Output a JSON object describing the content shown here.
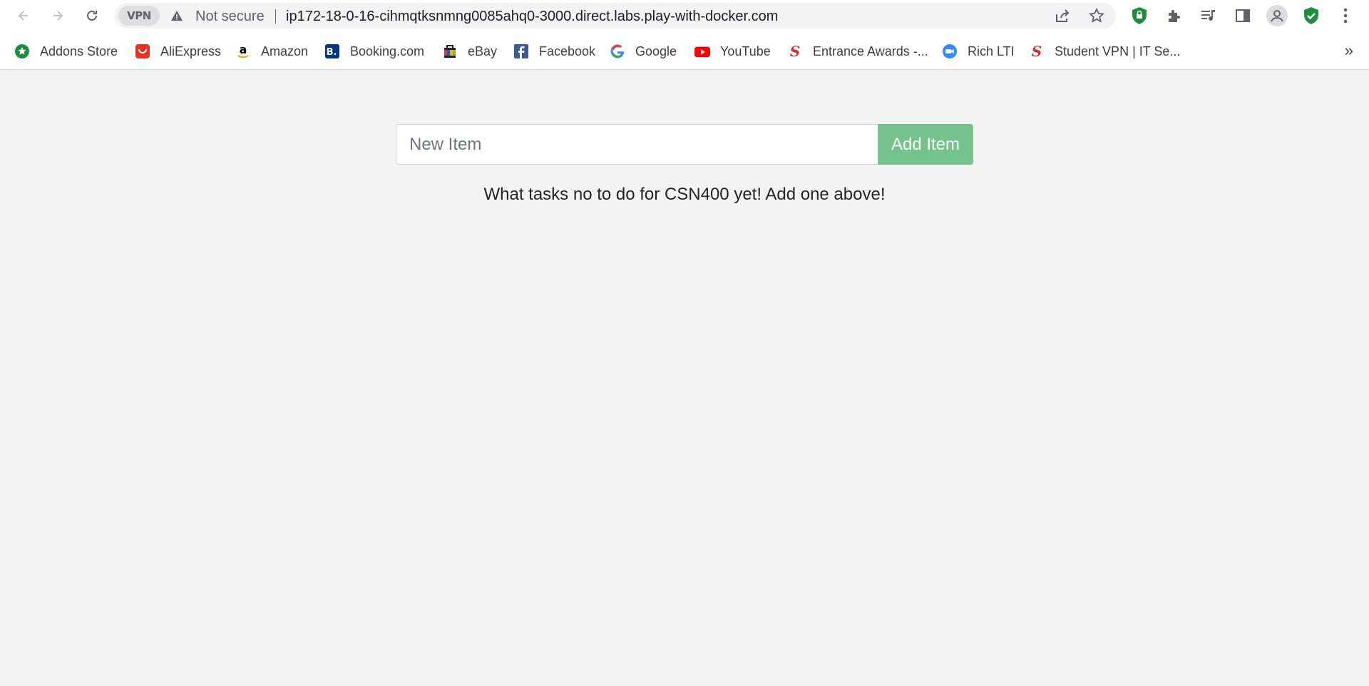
{
  "browser": {
    "vpn_label": "VPN",
    "security_label": "Not secure",
    "url": "ip172-18-0-16-cihmqtksnmng0085ahq0-3000.direct.labs.play-with-docker.com"
  },
  "bookmarks": [
    {
      "label": "Addons Store",
      "icon": "addons-store-icon",
      "color": "#1e8e3e"
    },
    {
      "label": "AliExpress",
      "icon": "aliexpress-icon",
      "color": "#e43225"
    },
    {
      "label": "Amazon",
      "icon": "amazon-icon",
      "color": "#000000"
    },
    {
      "label": "Booking.com",
      "icon": "booking-icon",
      "color": "#003580"
    },
    {
      "label": "eBay",
      "icon": "ebay-icon",
      "color": "#e53238"
    },
    {
      "label": "Facebook",
      "icon": "facebook-icon",
      "color": "#1877f2"
    },
    {
      "label": "Google",
      "icon": "google-icon",
      "color": "#4285f4"
    },
    {
      "label": "YouTube",
      "icon": "youtube-icon",
      "color": "#ff0000"
    },
    {
      "label": "Entrance Awards -...",
      "icon": "entrance-awards-icon",
      "color": "#d32f2f"
    },
    {
      "label": "Rich LTI",
      "icon": "zoom-icon",
      "color": "#2d8cff"
    },
    {
      "label": "Student VPN | IT Se...",
      "icon": "student-vpn-icon",
      "color": "#d32f2f"
    }
  ],
  "more_bookmarks_label": "»",
  "app": {
    "input_placeholder": "New Item",
    "input_value": "",
    "add_button_label": "Add Item",
    "empty_message": "What tasks no to do for CSN400 yet! Add one above!"
  },
  "colors": {
    "page_background": "#f3f3f3",
    "add_button": "#74c28c",
    "shield_green": "#1e8e3e"
  }
}
